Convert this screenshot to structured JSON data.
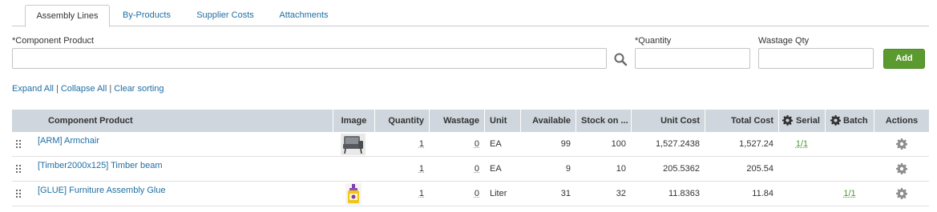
{
  "tabs": [
    {
      "label": "Assembly Lines",
      "active": true
    },
    {
      "label": "By-Products",
      "active": false
    },
    {
      "label": "Supplier Costs",
      "active": false
    },
    {
      "label": "Attachments",
      "active": false
    }
  ],
  "form": {
    "component_label": "*Component Product",
    "component_value": "",
    "quantity_label": "*Quantity",
    "quantity_value": "",
    "wastage_label": "Wastage Qty",
    "wastage_value": "",
    "add_label": "Add"
  },
  "links": {
    "expand_all": "Expand All",
    "collapse_all": "Collapse All",
    "clear_sorting": "Clear sorting",
    "separator": "|"
  },
  "table": {
    "headers": {
      "component": "Component Product",
      "image": "Image",
      "quantity": "Quantity",
      "wastage": "Wastage",
      "unit": "Unit",
      "available": "Available",
      "stock_on": "Stock on ...",
      "unit_cost": "Unit Cost",
      "total_cost": "Total Cost",
      "serial": "Serial",
      "batch": "Batch",
      "actions": "Actions"
    },
    "rows": [
      {
        "product": "[ARM] Armchair",
        "image": "armchair",
        "quantity": "1",
        "wastage": "0",
        "unit": "EA",
        "available": "99",
        "stock_on": "100",
        "unit_cost": "1,527.2438",
        "total_cost": "1,527.24",
        "serial": "1/1",
        "batch": ""
      },
      {
        "product": "[Timber2000x125] Timber beam",
        "image": "",
        "quantity": "1",
        "wastage": "0",
        "unit": "EA",
        "available": "9",
        "stock_on": "10",
        "unit_cost": "205.5362",
        "total_cost": "205.54",
        "serial": "",
        "batch": ""
      },
      {
        "product": "[GLUE] Furniture Assembly Glue",
        "image": "glue",
        "quantity": "1",
        "wastage": "0",
        "unit": "Liter",
        "available": "31",
        "stock_on": "32",
        "unit_cost": "11.8363",
        "total_cost": "11.84",
        "serial": "",
        "batch": "1/1"
      }
    ]
  },
  "colors": {
    "accent_link": "#1f6fa3",
    "add_button": "#5b9a2e",
    "header_bg": "#cfd6dd",
    "serial_link": "#4a9a2a"
  },
  "icons": {
    "search": "search-icon",
    "gear": "gear-icon",
    "drag": "drag-handle-icon"
  }
}
